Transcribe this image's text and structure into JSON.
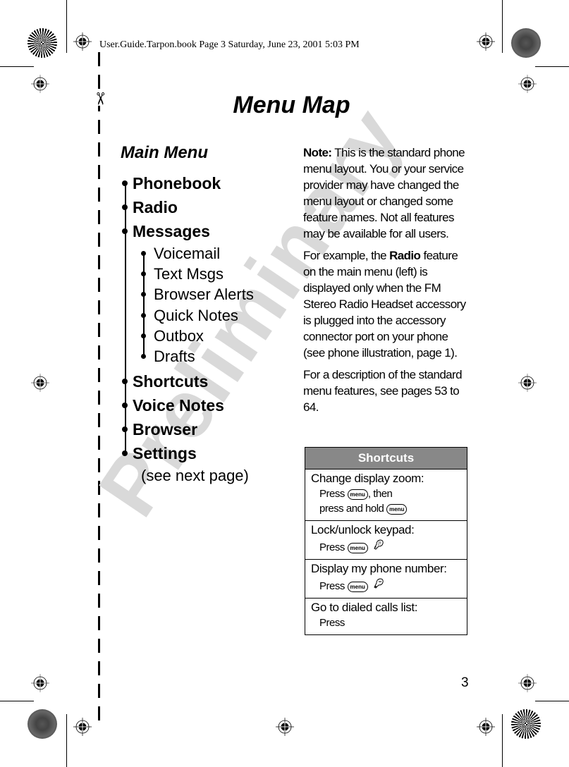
{
  "header": {
    "print_line": "User.Guide.Tarpon.book  Page 3  Saturday, June 23, 2001  5:03 PM"
  },
  "page": {
    "title": "Menu Map",
    "watermark": "Preliminary",
    "page_number": "3",
    "icons": {
      "scissors": "scissors-icon",
      "registration": "registration-mark-icon",
      "color_bar": "star-target-icon"
    }
  },
  "main_menu": {
    "heading": "Main Menu",
    "items": [
      {
        "label": "Phonebook"
      },
      {
        "label": "Radio"
      },
      {
        "label": "Messages",
        "subitems": [
          "Voicemail",
          "Text Msgs",
          "Browser Alerts",
          "Quick Notes",
          "Outbox",
          "Drafts"
        ]
      },
      {
        "label": "Shortcuts"
      },
      {
        "label": "Voice Notes"
      },
      {
        "label": "Browser"
      },
      {
        "label": "Settings",
        "note": "(see next page)"
      }
    ]
  },
  "note": {
    "label": "Note:",
    "paragraph1_rest": " This is the standard phone menu layout. You or your service provider may have changed the menu layout or changed some feature names. Not all features may be available for all users.",
    "paragraph2_pre": "For example, the ",
    "paragraph2_bold": "Radio",
    "paragraph2_post": " feature on the main menu (left) is displayed only when the FM Stereo Radio Headset accessory is plugged into the accessory connector port on your phone (see phone illustration, page 1).",
    "paragraph3": "For a description of the standard menu features, see pages 53 to 64."
  },
  "shortcuts": {
    "heading": "Shortcuts",
    "menu_key": "menu",
    "rows": [
      {
        "title": "Change display zoom:",
        "line1_pre": "Press ",
        "line1_post": ", then",
        "line2_pre": "press and hold "
      },
      {
        "title": "Lock/unlock keypad:",
        "line1_pre": "Press ",
        "key_icon": "key-star-icon"
      },
      {
        "title": "Display my phone number:",
        "line1_pre": "Press ",
        "key_icon": "key-hash-icon"
      },
      {
        "title": "Go to dialed calls list:",
        "line1_pre": "Press"
      }
    ]
  }
}
